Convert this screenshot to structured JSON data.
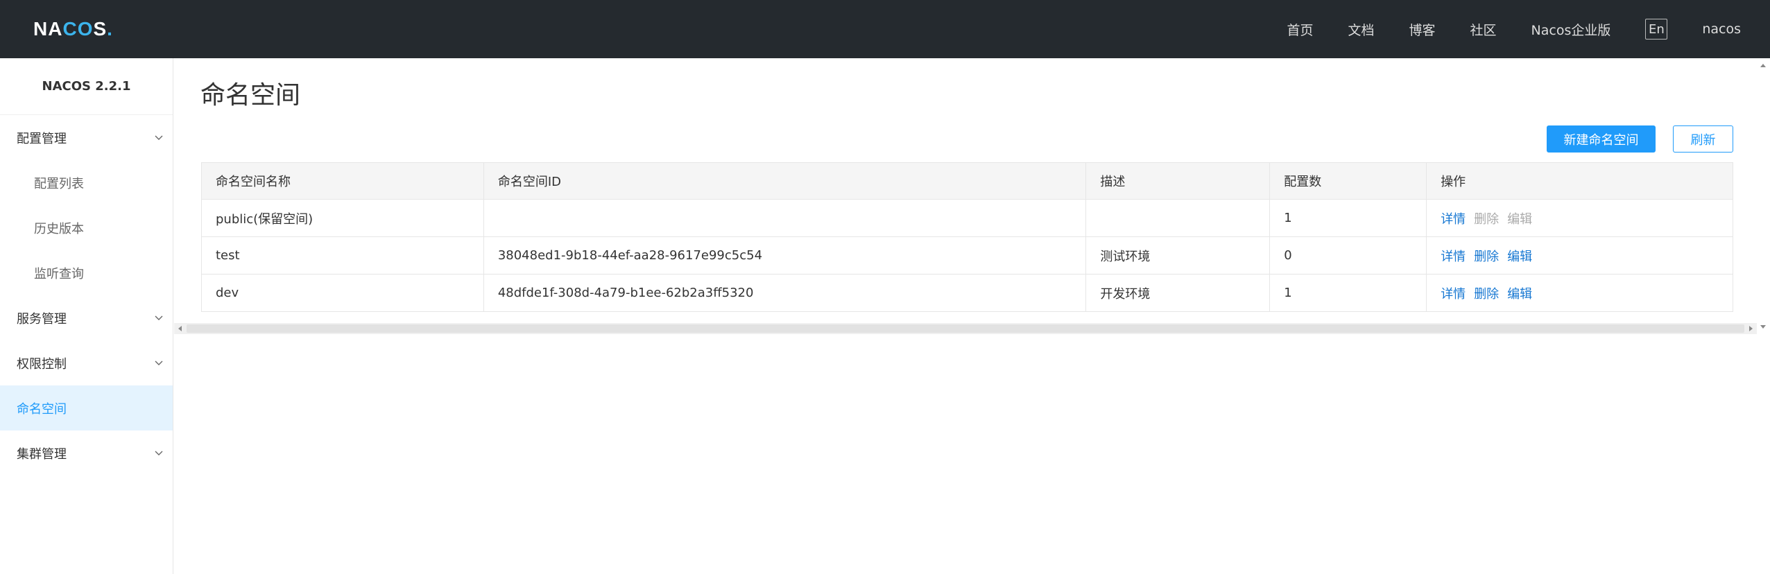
{
  "header": {
    "logo": {
      "part1": "NA",
      "part2": "C",
      "part3": "O",
      "part4": "S",
      "dot": "."
    },
    "nav": [
      "首页",
      "文档",
      "博客",
      "社区",
      "Nacos企业版"
    ],
    "lang": "En",
    "user": "nacos"
  },
  "sidebar": {
    "version": "NACOS 2.2.1",
    "items": [
      {
        "label": "配置管理",
        "type": "group",
        "icon": "chevron-down-icon"
      },
      {
        "label": "配置列表",
        "type": "sub"
      },
      {
        "label": "历史版本",
        "type": "sub"
      },
      {
        "label": "监听查询",
        "type": "sub"
      },
      {
        "label": "服务管理",
        "type": "group",
        "icon": "chevron-down-icon"
      },
      {
        "label": "权限控制",
        "type": "group",
        "icon": "chevron-down-icon"
      },
      {
        "label": "命名空间",
        "type": "active"
      },
      {
        "label": "集群管理",
        "type": "group",
        "icon": "chevron-down-icon"
      }
    ]
  },
  "main": {
    "title": "命名空间",
    "new_button": "新建命名空间",
    "refresh_button": "刷新",
    "table": {
      "headers": [
        "命名空间名称",
        "命名空间ID",
        "描述",
        "配置数",
        "操作"
      ],
      "rows": [
        {
          "name": "public(保留空间)",
          "id": "",
          "desc": "",
          "count": "1",
          "ops": [
            "详情",
            "删除",
            "编辑"
          ],
          "ops_enabled": [
            true,
            false,
            false
          ]
        },
        {
          "name": "test",
          "id": "38048ed1-9b18-44ef-aa28-9617e99c5c54",
          "desc": "测试环境",
          "count": "0",
          "ops": [
            "详情",
            "删除",
            "编辑"
          ],
          "ops_enabled": [
            true,
            true,
            true
          ]
        },
        {
          "name": "dev",
          "id": "48dfde1f-308d-4a79-b1ee-62b2a3ff5320",
          "desc": "开发环境",
          "count": "1",
          "ops": [
            "详情",
            "删除",
            "编辑"
          ],
          "ops_enabled": [
            true,
            true,
            true
          ]
        }
      ]
    }
  },
  "colors": {
    "header_bg": "#252a2f",
    "accent": "#209bfa",
    "link": "#1677d2",
    "active_bg": "#e4f3fe"
  }
}
